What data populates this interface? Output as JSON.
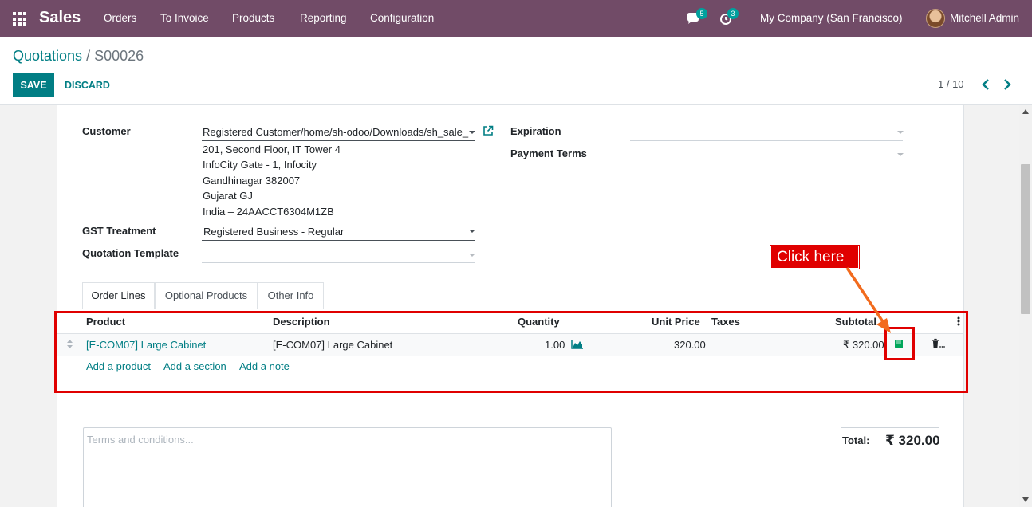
{
  "navbar": {
    "app_title": "Sales",
    "menu": [
      "Orders",
      "To Invoice",
      "Products",
      "Reporting",
      "Configuration"
    ],
    "messages_badge": "5",
    "activities_badge": "3",
    "company": "My Company (San Francisco)",
    "user": "Mitchell Admin"
  },
  "control_panel": {
    "breadcrumb_parent": "Quotations",
    "breadcrumb_sep": "/",
    "breadcrumb_current": "S00026",
    "save_label": "SAVE",
    "discard_label": "DISCARD",
    "pager": "1 / 10"
  },
  "form": {
    "customer_label": "Customer",
    "customer_value": "Registered Customer/home/sh-odoo/Downloads/sh_sale_",
    "address": [
      "201, Second Floor, IT Tower 4",
      "InfoCity Gate - 1, Infocity",
      "Gandhinagar 382007",
      "Gujarat GJ",
      "India – 24AACCT6304M1ZB"
    ],
    "gst_label": "GST Treatment",
    "gst_value": "Registered Business - Regular",
    "template_label": "Quotation Template",
    "template_value": "",
    "expiration_label": "Expiration",
    "payment_terms_label": "Payment Terms"
  },
  "tabs": [
    "Order Lines",
    "Optional Products",
    "Other Info"
  ],
  "order_table": {
    "headers": [
      "Product",
      "Description",
      "Quantity",
      "Unit Price",
      "Taxes",
      "Subtotal"
    ],
    "rows": [
      {
        "product": "[E-COM07] Large Cabinet",
        "description": "[E-COM07] Large Cabinet",
        "quantity": "1.00",
        "unit_price": "320.00",
        "taxes": "",
        "subtotal": "₹ 320.00"
      }
    ],
    "add_links": [
      "Add a product",
      "Add a section",
      "Add a note"
    ]
  },
  "footer": {
    "terms_placeholder": "Terms and conditions...",
    "total_label": "Total:",
    "total_value": "₹ 320.00"
  },
  "annotation": {
    "callout": "Click here",
    "color": "#e00000",
    "arrow_color": "#f26b1d"
  },
  "colors": {
    "navbar": "#714b67",
    "primary": "#017e84",
    "book_icon": "#00a65a"
  }
}
